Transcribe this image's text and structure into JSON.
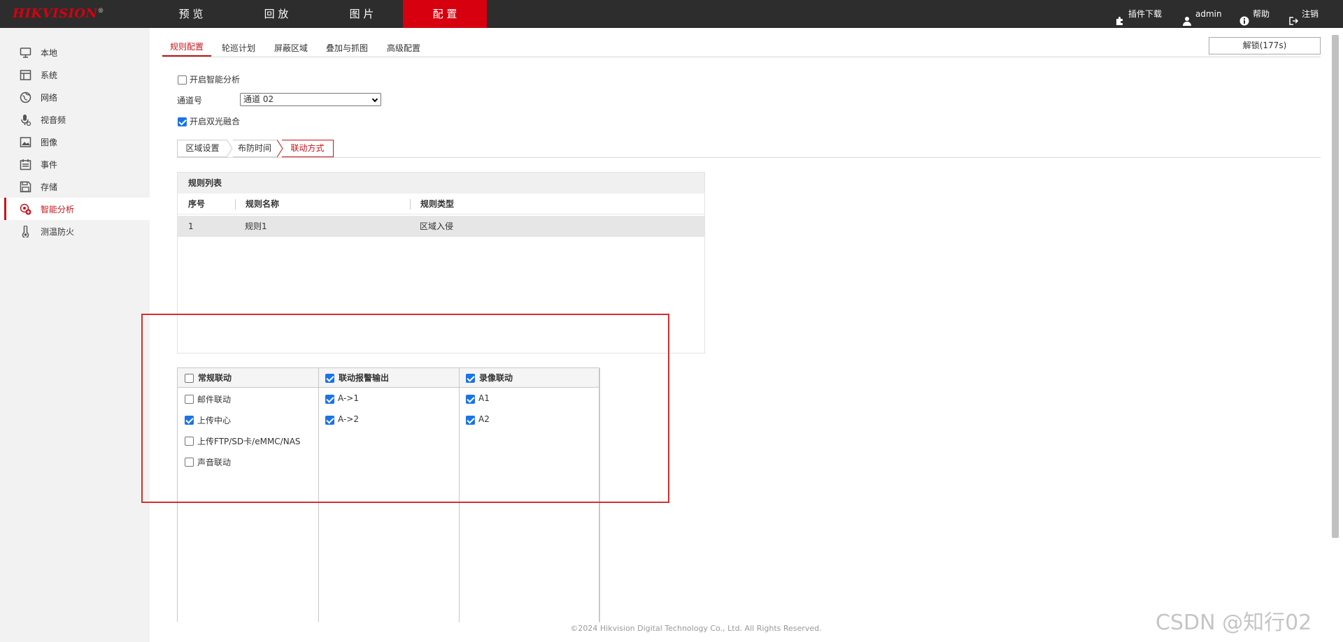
{
  "brand": {
    "logo": "HIKVISION",
    "mark": "®",
    "accent": "#d7000f"
  },
  "nav": {
    "items": [
      {
        "label": "预 览"
      },
      {
        "label": "回 放"
      },
      {
        "label": "图 片"
      },
      {
        "label": "配 置",
        "active": true
      }
    ],
    "plugin_download": "插件下载",
    "user": "admin",
    "help": "帮助",
    "logout": "注销"
  },
  "sidebar": {
    "items": [
      {
        "label": "本地",
        "icon": "monitor-icon"
      },
      {
        "label": "系统",
        "icon": "window-icon"
      },
      {
        "label": "网络",
        "icon": "globe-icon"
      },
      {
        "label": "视音频",
        "icon": "microphone-icon"
      },
      {
        "label": "图像",
        "icon": "image-icon"
      },
      {
        "label": "事件",
        "icon": "calendar-icon"
      },
      {
        "label": "存储",
        "icon": "save-icon"
      },
      {
        "label": "智能分析",
        "icon": "smart-analysis-icon",
        "active": true
      },
      {
        "label": "测温防火",
        "icon": "thermometer-icon"
      }
    ]
  },
  "main_tabs": {
    "items": [
      {
        "label": "规则配置",
        "active": true
      },
      {
        "label": "轮巡计划"
      },
      {
        "label": "屏蔽区域"
      },
      {
        "label": "叠加与抓图"
      },
      {
        "label": "高级配置"
      }
    ],
    "unlock_button": "解锁(177s)"
  },
  "form": {
    "enable_smart": {
      "label": "开启智能分析",
      "checked": false
    },
    "channel": {
      "label": "通道号",
      "value": "通道 02"
    },
    "enable_fusion": {
      "label": "开启双光融合",
      "checked": true
    }
  },
  "steps": {
    "items": [
      {
        "label": "区域设置"
      },
      {
        "label": "布防时间"
      },
      {
        "label": "联动方式",
        "active": true
      }
    ]
  },
  "rule_list": {
    "title": "规则列表",
    "columns": [
      "序号",
      "规则名称",
      "规则类型"
    ],
    "rows": [
      {
        "index": "1",
        "name": "规则1",
        "type": "区域入侵"
      }
    ]
  },
  "linkage": {
    "columns": [
      {
        "header": "常规联动",
        "checked": false,
        "items": [
          {
            "label": "邮件联动",
            "checked": false
          },
          {
            "label": "上传中心",
            "checked": true
          },
          {
            "label": "上传FTP/SD卡/eMMC/NAS",
            "checked": false
          },
          {
            "label": "声音联动",
            "checked": false
          }
        ]
      },
      {
        "header": "联动报警输出",
        "checked": true,
        "items": [
          {
            "label": "A->1",
            "checked": true
          },
          {
            "label": "A->2",
            "checked": true
          }
        ]
      },
      {
        "header": "录像联动",
        "checked": true,
        "items": [
          {
            "label": "A1",
            "checked": true
          },
          {
            "label": "A2",
            "checked": true
          }
        ]
      }
    ]
  },
  "footer": "©2024 Hikvision Digital Technology Co., Ltd. All Rights Reserved.",
  "watermark": "CSDN @知行02",
  "colors": {
    "accent_red": "#c4161c",
    "topbar": "#2d2d2d",
    "sidebar": "#f2f2f2",
    "checkbox_blue": "#1a73e8",
    "highlight_box": "#d32f2f"
  }
}
